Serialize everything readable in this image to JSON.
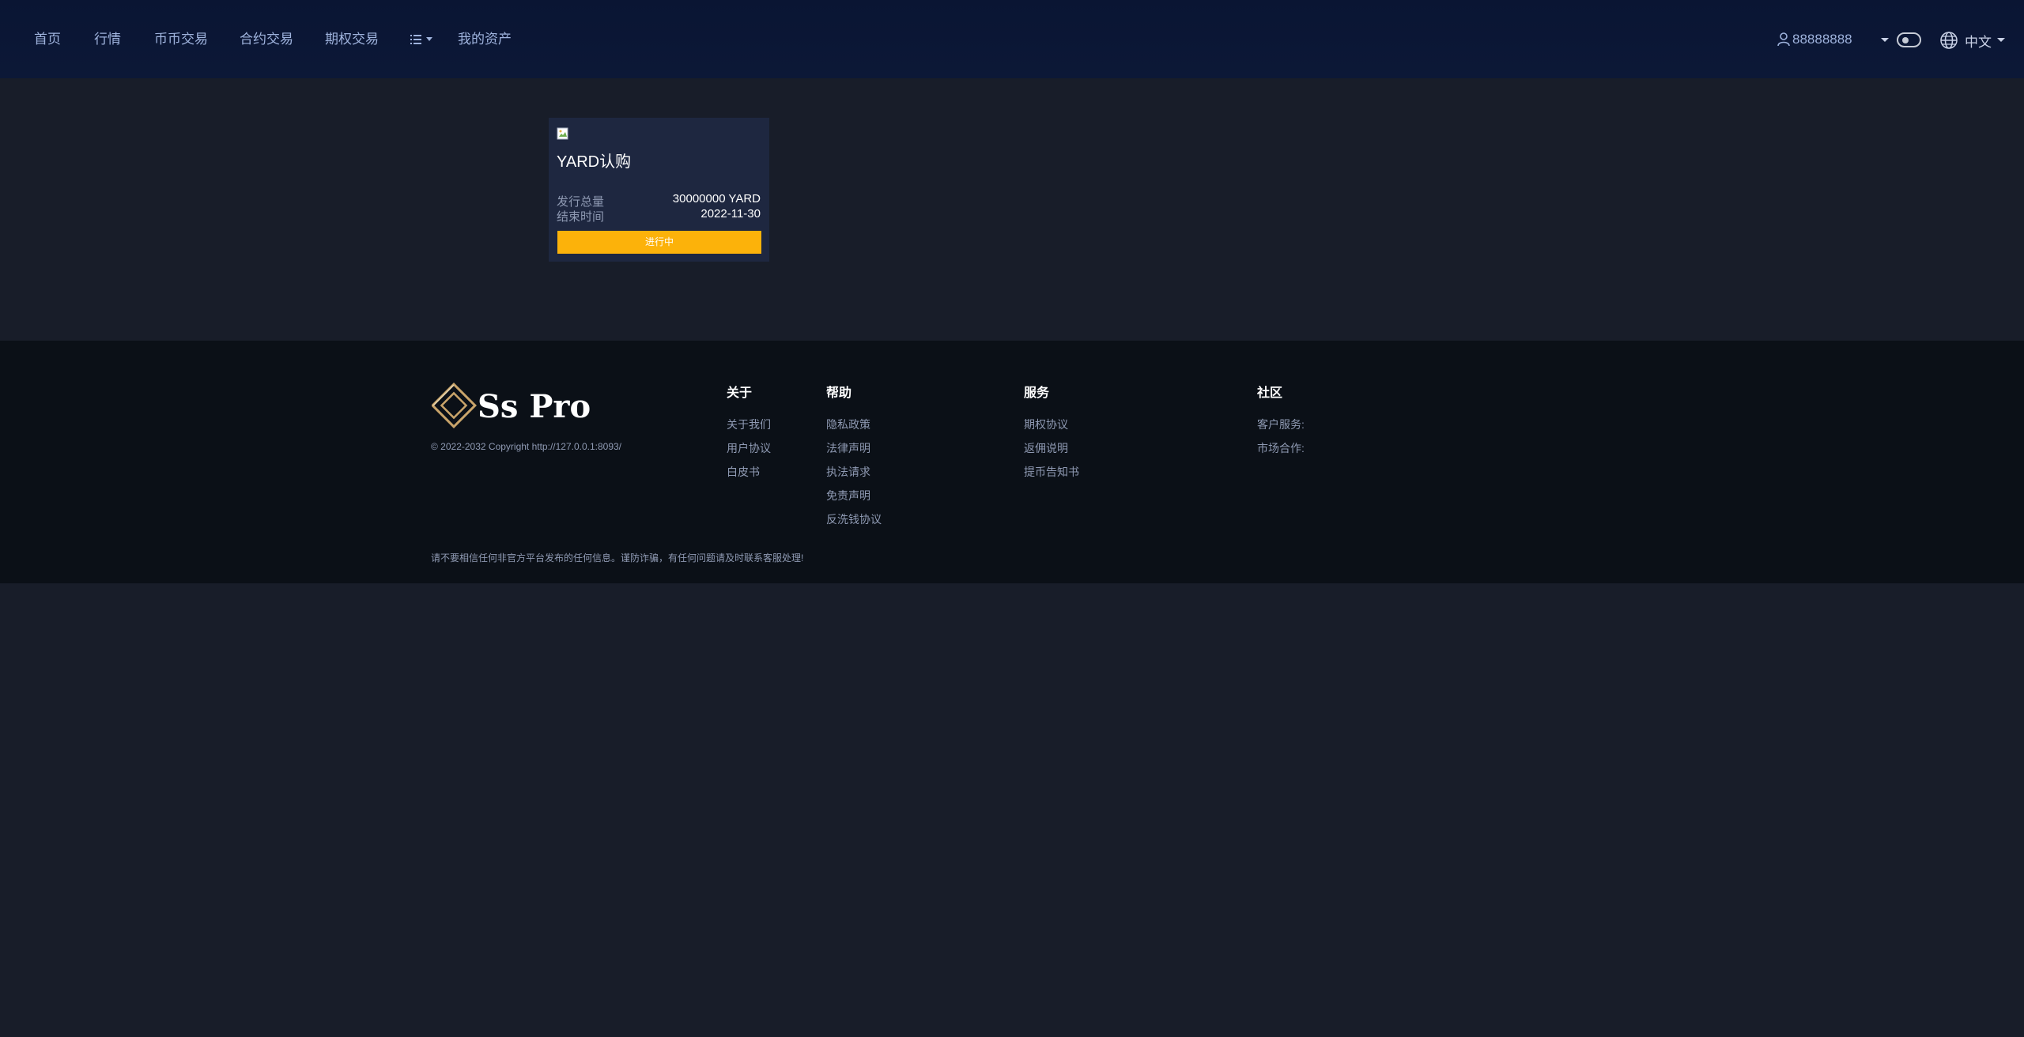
{
  "colors": {
    "header_bg": "#0a1533",
    "page_bg": "#181d29",
    "card_bg": "#1e2740",
    "footer_bg": "#0b1017",
    "accent": "#fcb20a",
    "nav_text": "#9fb3dd"
  },
  "nav": {
    "items": [
      "首页",
      "行情",
      "币币交易",
      "合约交易",
      "期权交易"
    ],
    "more_icon": "list-icon",
    "assets": "我的资产",
    "user": "88888888",
    "user_icon": "user-icon",
    "lang": "中文",
    "lang_icon": "globe-icon"
  },
  "card": {
    "image_icon": "broken-image-icon",
    "title": "YARD认购",
    "rows": [
      {
        "label": "发行总量",
        "value": "30000000 YARD"
      },
      {
        "label": "结束时间",
        "value": "2022-11-30"
      }
    ],
    "status": "进行中"
  },
  "footer": {
    "logo_text": "Ss Pro",
    "copyright": "© 2022-2032 Copyright http://127.0.0.1:8093/",
    "columns": [
      {
        "title": "关于",
        "links": [
          "关于我们",
          "用户协议",
          "白皮书"
        ]
      },
      {
        "title": "帮助",
        "links": [
          "隐私政策",
          "法律声明",
          "执法请求",
          "免责声明",
          "反洗钱协议"
        ]
      },
      {
        "title": "服务",
        "links": [
          "期权协议",
          "返佣说明",
          "提币告知书"
        ]
      },
      {
        "title": "社区",
        "links": [
          "客户服务:",
          "市场合作:"
        ]
      }
    ],
    "disclaimer": "请不要相信任何非官方平台发布的任何信息。谨防诈骗，有任何问题请及时联系客服处理!"
  }
}
